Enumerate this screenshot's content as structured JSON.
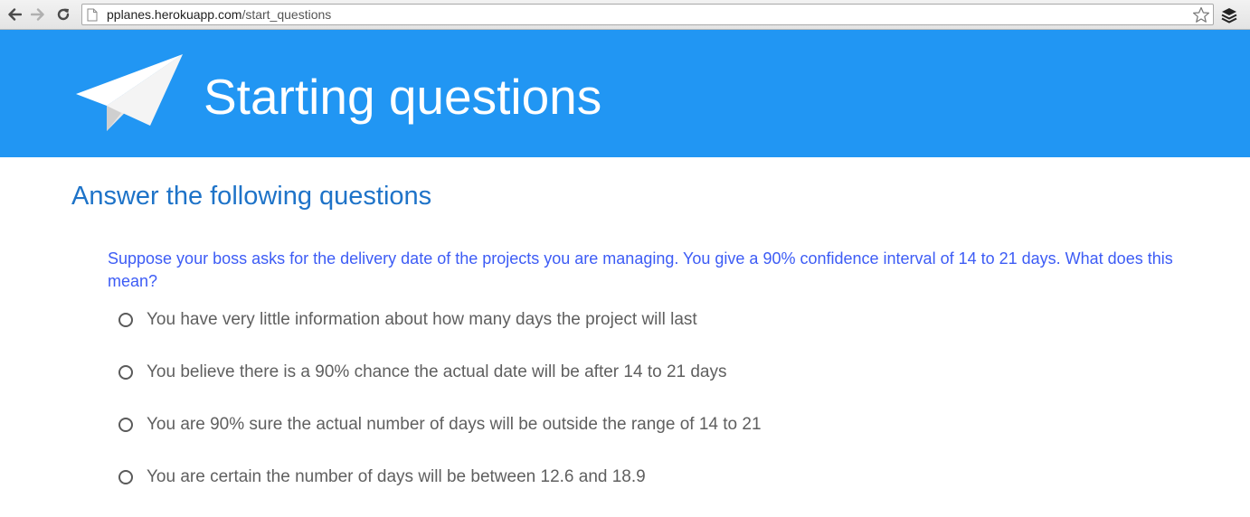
{
  "browser": {
    "url_host": "pplanes.herokuapp.com",
    "url_path": "/start_questions",
    "icons": [
      "back-arrow-icon",
      "forward-arrow-icon",
      "reload-icon",
      "page-icon",
      "star-icon",
      "layers-extension-icon"
    ]
  },
  "header": {
    "title": "Starting questions",
    "logo_icon": "paper-plane-icon",
    "background_color": "#2196f3"
  },
  "main": {
    "heading": "Answer the following questions",
    "question": "Suppose your boss asks for the delivery date of the projects you are managing. You give a 90% confidence interval of 14 to 21 days. What does this mean?",
    "options": [
      {
        "label": "You have very little information about how many days the project will last",
        "checked": false
      },
      {
        "label": "You believe there is a 90% chance the actual date will be after 14 to 21 days",
        "checked": false
      },
      {
        "label": "You are 90% sure the actual number of days will be outside the range of 14 to 21",
        "checked": false
      },
      {
        "label": "You are certain the number of days will be between 12.6 and 18.9",
        "checked": false
      }
    ]
  },
  "colors": {
    "heading": "#1e73c8",
    "question": "#3d5cf5",
    "option_text": "#5f5f5f"
  }
}
